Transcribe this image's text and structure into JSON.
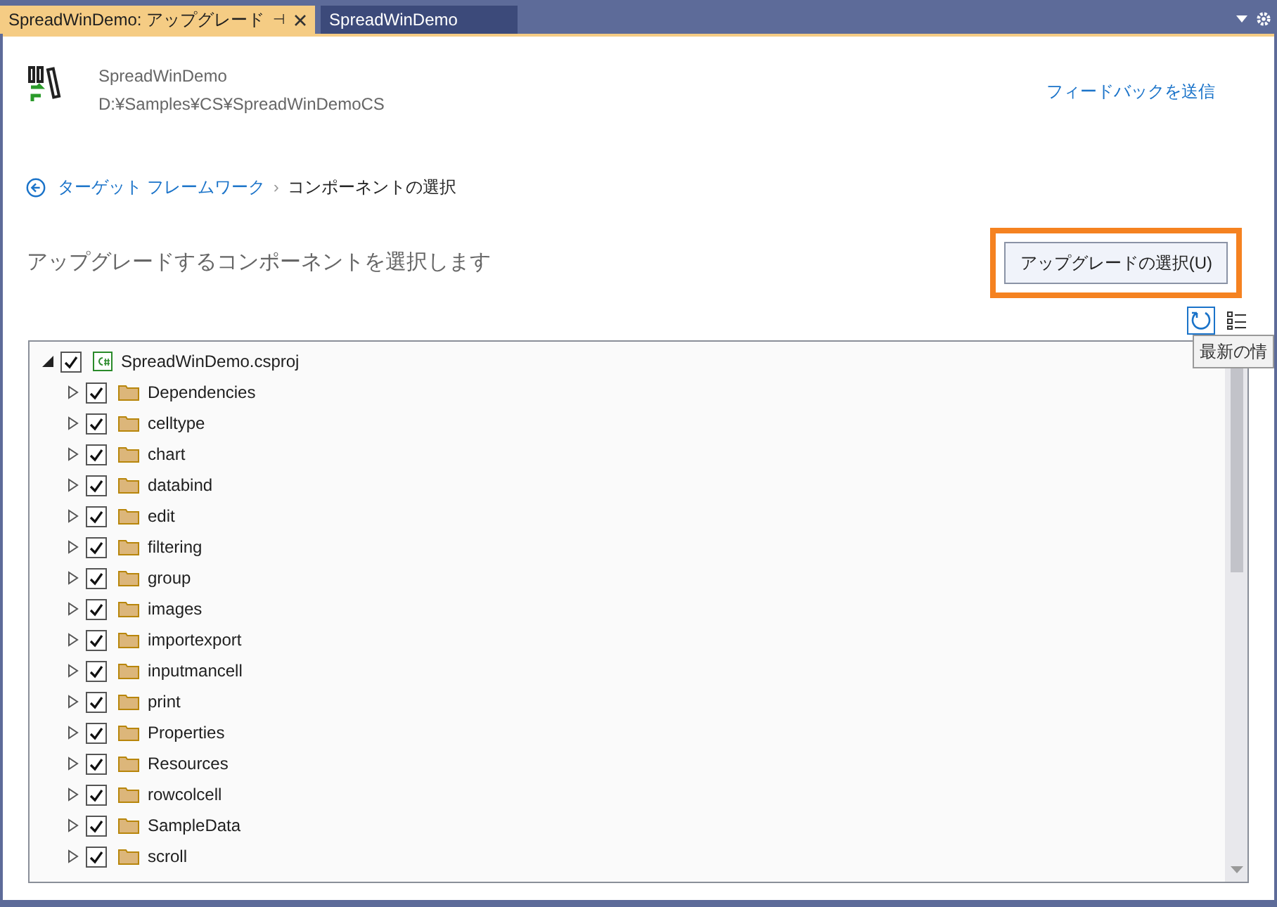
{
  "tabs": [
    {
      "label": "SpreadWinDemo: アップグレード",
      "selected": true,
      "pin": "⊣"
    },
    {
      "label": "SpreadWinDemo",
      "selected": false
    }
  ],
  "project": {
    "name": "SpreadWinDemo",
    "path": "D:¥Samples¥CS¥SpreadWinDemoCS"
  },
  "feedback_link": "フィードバックを送信",
  "breadcrumb": {
    "link": "ターゲット フレームワーク",
    "separator": "›",
    "current": "コンポーネントの選択"
  },
  "heading": "アップグレードするコンポーネントを選択します",
  "select_button": "アップグレードの選択(U)",
  "tooltip": "最新の情",
  "tree": [
    {
      "label": "SpreadWinDemo.csproj",
      "kind": "project",
      "checked": true,
      "expanded": true,
      "children": [
        {
          "label": "Dependencies",
          "kind": "folder",
          "checked": true,
          "expanded": false
        },
        {
          "label": "celltype",
          "kind": "folder",
          "checked": true,
          "expanded": false
        },
        {
          "label": "chart",
          "kind": "folder",
          "checked": true,
          "expanded": false
        },
        {
          "label": "databind",
          "kind": "folder",
          "checked": true,
          "expanded": false
        },
        {
          "label": "edit",
          "kind": "folder",
          "checked": true,
          "expanded": false
        },
        {
          "label": "filtering",
          "kind": "folder",
          "checked": true,
          "expanded": false
        },
        {
          "label": "group",
          "kind": "folder",
          "checked": true,
          "expanded": false
        },
        {
          "label": "images",
          "kind": "folder",
          "checked": true,
          "expanded": false
        },
        {
          "label": "importexport",
          "kind": "folder",
          "checked": true,
          "expanded": false
        },
        {
          "label": "inputmancell",
          "kind": "folder",
          "checked": true,
          "expanded": false
        },
        {
          "label": "print",
          "kind": "folder",
          "checked": true,
          "expanded": false
        },
        {
          "label": "Properties",
          "kind": "folder",
          "checked": true,
          "expanded": false
        },
        {
          "label": "Resources",
          "kind": "folder",
          "checked": true,
          "expanded": false
        },
        {
          "label": "rowcolcell",
          "kind": "folder",
          "checked": true,
          "expanded": false
        },
        {
          "label": "SampleData",
          "kind": "folder",
          "checked": true,
          "expanded": false
        },
        {
          "label": "scroll",
          "kind": "folder",
          "checked": true,
          "expanded": false
        }
      ]
    }
  ]
}
